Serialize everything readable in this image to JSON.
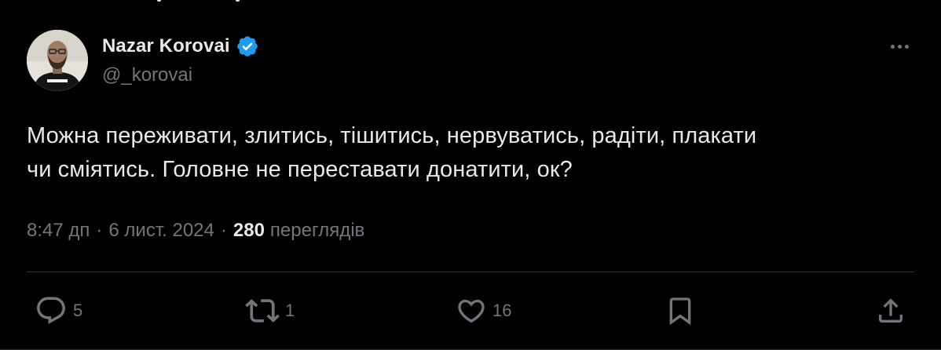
{
  "author": {
    "display_name": "Nazar Korovai",
    "handle": "@_korovai",
    "verified": true,
    "verified_color": "#1d9bf0"
  },
  "tweet": {
    "text_line1": "Можна переживати, злитись, тішитись, нервуватись, радіти, плакати",
    "text_line2": "чи сміятись. Головне не переставати донатити, ок?"
  },
  "meta": {
    "time": "8:47 дп",
    "separator": "·",
    "date": "6 лист. 2024",
    "views_count": "280",
    "views_label": "переглядів"
  },
  "actions": {
    "reply": {
      "icon": "reply-icon",
      "count": "5"
    },
    "retweet": {
      "icon": "retweet-icon",
      "count": "1"
    },
    "like": {
      "icon": "heart-icon",
      "count": "16"
    },
    "bookmark": {
      "icon": "bookmark-icon"
    },
    "share": {
      "icon": "share-icon"
    }
  },
  "colors": {
    "background": "#000000",
    "primary_text": "#e7e9ea",
    "secondary_text": "#71767b",
    "divider": "#2f3336"
  }
}
